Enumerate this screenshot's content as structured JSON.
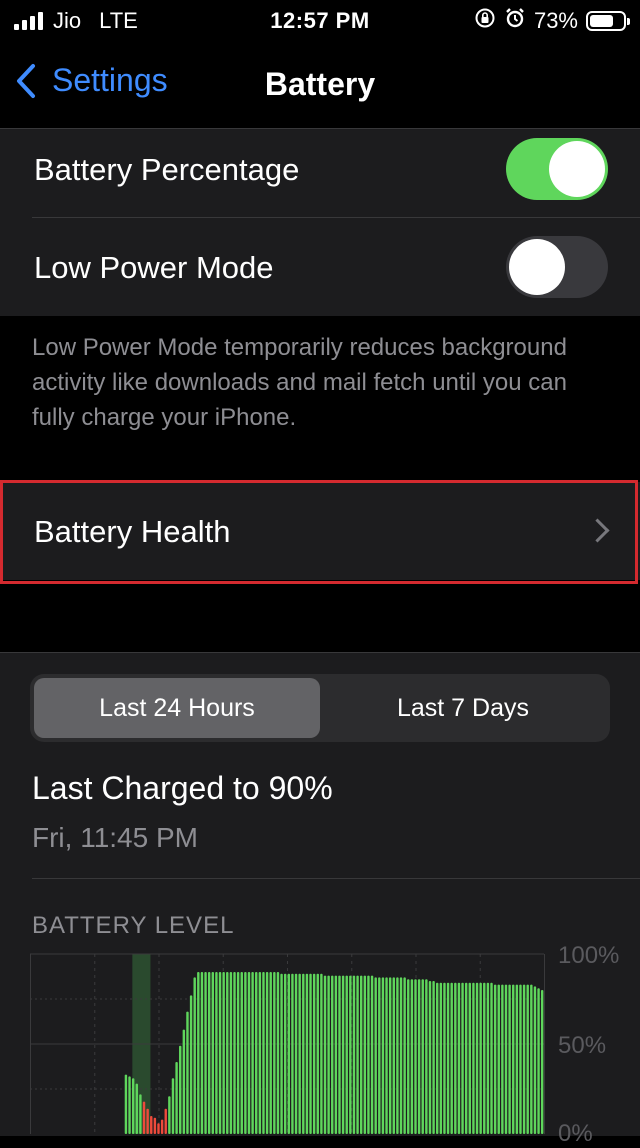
{
  "status_bar": {
    "carrier": "Jio",
    "network": "LTE",
    "time": "12:57 PM",
    "battery_percent": "73%",
    "battery_level": 0.73
  },
  "nav": {
    "back_label": "Settings",
    "title": "Battery"
  },
  "settings": {
    "battery_percentage": {
      "label": "Battery Percentage",
      "enabled": true
    },
    "low_power_mode": {
      "label": "Low Power Mode",
      "enabled": false
    },
    "low_power_footer": "Low Power Mode temporarily reduces background activity like downloads and mail fetch until you can fully charge your iPhone.",
    "battery_health": {
      "label": "Battery Health"
    }
  },
  "usage": {
    "tabs": [
      {
        "label": "Last 24 Hours",
        "selected": true
      },
      {
        "label": "Last 7 Days",
        "selected": false
      }
    ],
    "last_charged": "Last Charged to 90%",
    "last_charged_time": "Fri, 11:45 PM",
    "chart_title": "BATTERY LEVEL"
  },
  "chart_data": {
    "type": "bar",
    "title": "BATTERY LEVEL",
    "ylim": [
      0,
      100
    ],
    "y_ticks": [
      "100%",
      "50%",
      "0%"
    ],
    "grid": true,
    "colors": {
      "normal": "#5fd65c",
      "low": "#ee4a3b",
      "charging_low": "#f5d63d",
      "charging_band": "#2a4a2e"
    },
    "charging_band": [
      28,
      33
    ],
    "values": [
      0,
      0,
      0,
      0,
      0,
      0,
      0,
      0,
      0,
      0,
      0,
      0,
      0,
      0,
      0,
      0,
      0,
      0,
      0,
      0,
      0,
      0,
      0,
      0,
      0,
      0,
      33,
      32,
      31,
      28,
      22,
      18,
      14,
      10,
      9,
      6,
      8,
      14,
      21,
      31,
      40,
      49,
      58,
      68,
      77,
      87,
      90,
      90,
      90,
      90,
      90,
      90,
      90,
      90,
      90,
      90,
      90,
      90,
      90,
      90,
      90,
      90,
      90,
      90,
      90,
      90,
      90,
      90,
      90,
      89,
      89,
      89,
      89,
      89,
      89,
      89,
      89,
      89,
      89,
      89,
      89,
      88,
      88,
      88,
      88,
      88,
      88,
      88,
      88,
      88,
      88,
      88,
      88,
      88,
      88,
      87,
      87,
      87,
      87,
      87,
      87,
      87,
      87,
      87,
      86,
      86,
      86,
      86,
      86,
      86,
      85,
      85,
      84,
      84,
      84,
      84,
      84,
      84,
      84,
      84,
      84,
      84,
      84,
      84,
      84,
      84,
      84,
      84,
      83,
      83,
      83,
      83,
      83,
      83,
      83,
      83,
      83,
      83,
      83,
      82,
      81,
      80
    ]
  }
}
